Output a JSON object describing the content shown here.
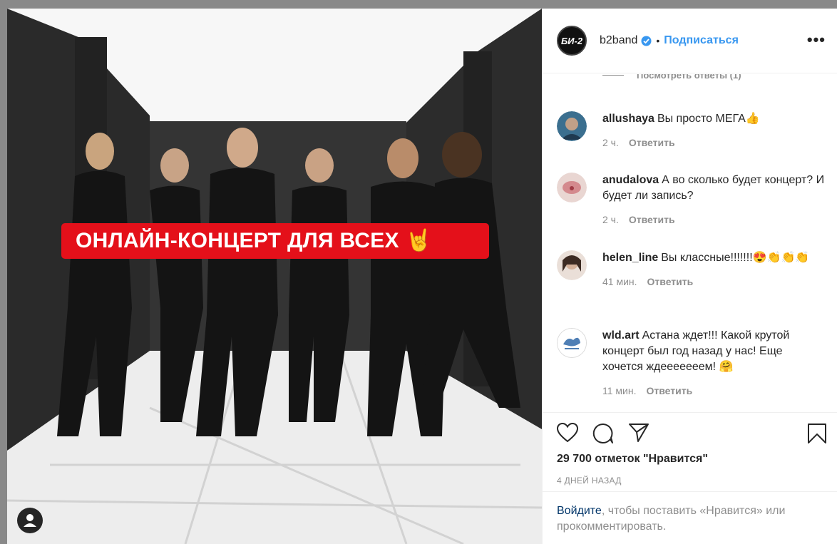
{
  "photo": {
    "banner_text": "ОНЛАЙН-КОНЦЕРТ ДЛЯ ВСЕХ 🤘"
  },
  "header": {
    "logo_text": "БИ-2",
    "username": "b2band",
    "separator": "•",
    "follow_label": "Подписаться",
    "more_label": "•••"
  },
  "view_replies": "Посмотреть ответы (1)",
  "comments": [
    {
      "user": "allushaya",
      "text": "Вы просто МЕГА👍",
      "time": "2 ч.",
      "reply": "Ответить"
    },
    {
      "user": "anudalova",
      "text": "А во сколько будет концерт? И будет ли запись?",
      "time": "2 ч.",
      "reply": "Ответить"
    },
    {
      "user": "helen_line",
      "text": "Вы классные!!!!!!!😍👏👏👏",
      "time": "41 мин.",
      "reply": "Ответить"
    },
    {
      "user": "wld.art",
      "text": "Астана ждет!!! Какой крутой концерт был год назад у нас! Еще хочется ждееееееем! 🤗",
      "time": "11 мин.",
      "reply": "Ответить"
    }
  ],
  "likes": "29 700 отметок \"Нравится\"",
  "date": "4 ДНЕЙ НАЗАД",
  "login": {
    "link": "Войдите",
    "rest": ", чтобы поставить «Нравится» или прокомментировать."
  },
  "colors": {
    "link_blue": "#3897f0",
    "banner_red": "#e4101a",
    "muted": "#8e8e8e",
    "text": "#262626"
  }
}
